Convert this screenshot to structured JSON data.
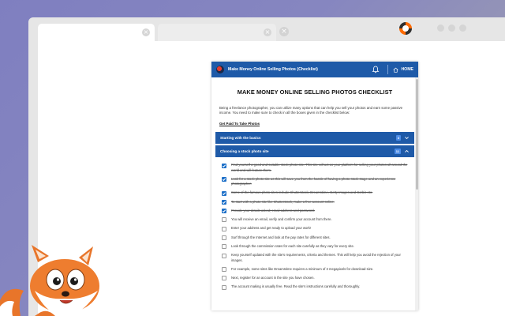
{
  "browser": {
    "tab_close_glyph": "×",
    "new_tab_glyph": "×"
  },
  "popup": {
    "header_title": "Make Money Online Selling Photos (Checklist)",
    "home_label": "HOME",
    "page_title": "MAKE MONEY ONLINE SELLING PHOTOS CHECKLIST",
    "intro": "Being a freelance photographer, you can utilize many options that can help you sell your photos and earn some passive income. You need to make sure to check in all the boxes given in the checklist below:",
    "cta_link": "Get Paid To Take Photos",
    "sections": [
      {
        "label": "Starting with the basics",
        "badge": "3",
        "expanded": false
      },
      {
        "label": "Choosing a stock photo site",
        "badge": "11",
        "expanded": true
      }
    ],
    "items": [
      {
        "text": "Find yourself a good and suitable stock photo site. This site will act as your platform for selling your photos all around the world and will feature them.",
        "checked": true
      },
      {
        "text": "Look for a stock photo site as this will save you from the hassle of having a photo-stock stage and an experience photographer.",
        "checked": true
      },
      {
        "text": "Some of the famous photo sites include Shutterstock, Dreamstime, Getty Images and Corbis etc.",
        "checked": true
      },
      {
        "text": "To start with a photo site like Shutterstock, make a free account online.",
        "checked": true
      },
      {
        "text": "Provide your details asked; email address and password.",
        "checked": true
      },
      {
        "text": "You will receive an email, verify and confirm your account from there.",
        "checked": false
      },
      {
        "text": "Enter your address and get ready to upload your work!",
        "checked": false
      },
      {
        "text": "Surf through the Internet and look at the pay rates for different sites.",
        "checked": false
      },
      {
        "text": "Look through the commission rates for each site carefully as they vary for every site.",
        "checked": false
      },
      {
        "text": "Keep yourself updated with the site's requirements, criteria and themes. This will help you avoid the rejection of your images.",
        "checked": false
      },
      {
        "text": "For example, some sites like Dreamstime requires a minimum of 3 megapixels for download-size.",
        "checked": false
      },
      {
        "text": "Next, register for an account in the site you have chosen.",
        "checked": false
      },
      {
        "text": "The account making is usually free. Read the site's instructions carefully and thoroughly.",
        "checked": false
      }
    ]
  },
  "colors": {
    "brand_blue": "#1e5aa8",
    "badge_blue": "#4b8be6",
    "check_blue": "#1e70c8"
  }
}
